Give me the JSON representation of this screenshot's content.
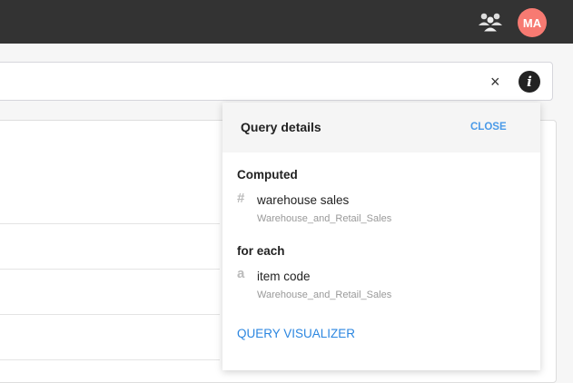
{
  "header": {
    "avatar_initials": "MA",
    "team_icon": "users-icon"
  },
  "search": {
    "clear_icon": "×",
    "info_icon": "i"
  },
  "query_details": {
    "title": "Query details",
    "close_label": "CLOSE",
    "computed_heading": "Computed",
    "computed": [
      {
        "icon": "#",
        "name": "warehouse sales",
        "source": "Warehouse_and_Retail_Sales"
      }
    ],
    "for_each_heading": "for each",
    "for_each": [
      {
        "icon": "a",
        "name": "item code",
        "source": "Warehouse_and_Retail_Sales"
      }
    ],
    "visualizer_label": "QUERY VISUALIZER"
  }
}
